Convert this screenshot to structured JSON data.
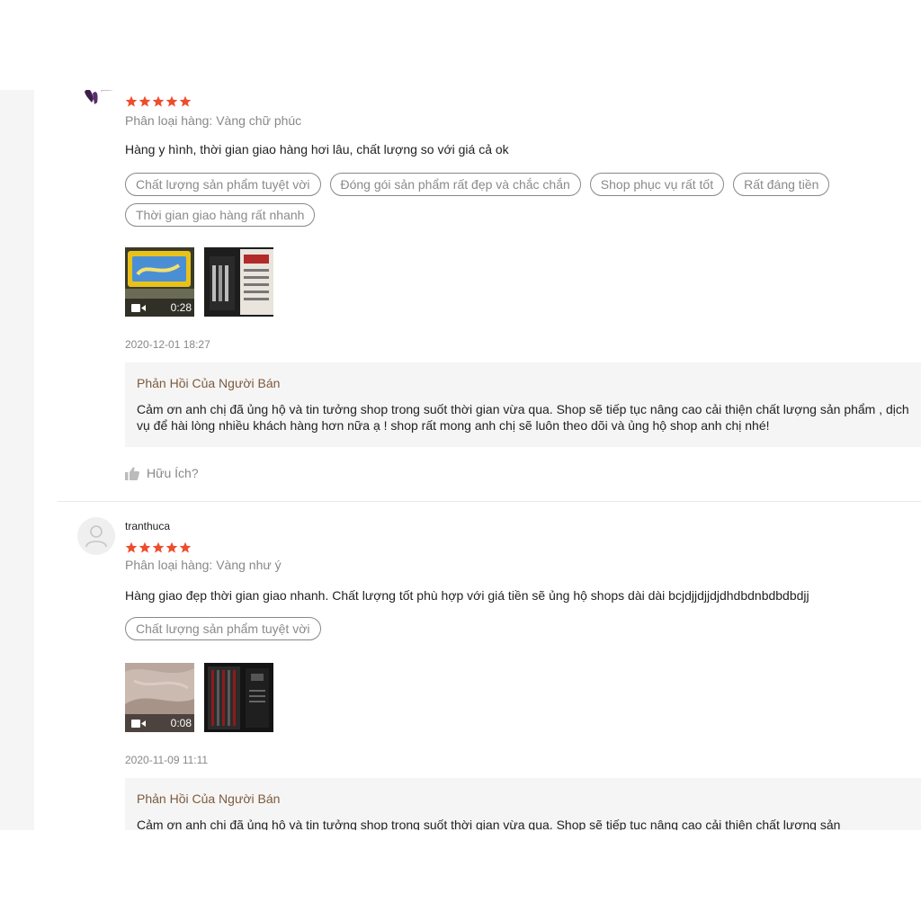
{
  "reviews": [
    {
      "username": "",
      "rating": 5,
      "variant": "Phân loại hàng: Vàng chữ phúc",
      "comment": "Hàng y hình, thời gian giao hàng hơi lâu, chất lượng so với giá cả ok",
      "tags": [
        "Chất lượng sản phẩm tuyệt vời",
        "Đóng gói sản phẩm rất đẹp và chắc chắn",
        "Shop phục vụ rất tốt",
        "Rất đáng tiền",
        "Thời gian giao hàng rất nhanh"
      ],
      "video_duration": "0:28",
      "date": "2020-12-01 18:27",
      "seller_reply_title": "Phản Hồi Của Người Bán",
      "seller_reply": "Cảm ơn anh chị đã ủng hộ và tin tưởng shop trong suốt thời gian vừa qua. Shop sẽ tiếp tục nâng cao cải thiện chất lượng sản phẩm , dịch vụ để hài lòng nhiều khách hàng hơn nữa ạ ! shop  rất mong anh chị sẽ luôn theo dõi và ủng hộ shop anh chị nhé!",
      "helpful_label": "Hữu Ích?"
    },
    {
      "username": "tranthuca",
      "rating": 5,
      "variant": "Phân loại hàng: Vàng như ý",
      "comment": "Hàng giao đẹp thời gian giao nhanh. Chất lượng tốt phù hợp với giá tiền sẽ ủng hộ shops dài dài bcjdjjdjjdjdhdbdnbdbdbdjj",
      "tags": [
        "Chất lượng sản phẩm tuyệt vời"
      ],
      "video_duration": "0:08",
      "date": "2020-11-09 11:11",
      "seller_reply_title": "Phản Hồi Của Người Bán",
      "seller_reply": "Cảm ơn anh chị đã ủng hộ và tin tưởng shop trong suốt thời gian vừa qua. Shop sẽ tiếp tục nâng cao cải thiện chất lượng sản"
    }
  ],
  "colors": {
    "star": "#ee4d2d",
    "reply_title": "#7d5a3c",
    "reply_bg": "#f5f5f5"
  },
  "icons": {
    "star": "star-icon",
    "video": "video-camera-icon",
    "like": "thumbs-up-icon",
    "user": "user-placeholder-icon"
  }
}
